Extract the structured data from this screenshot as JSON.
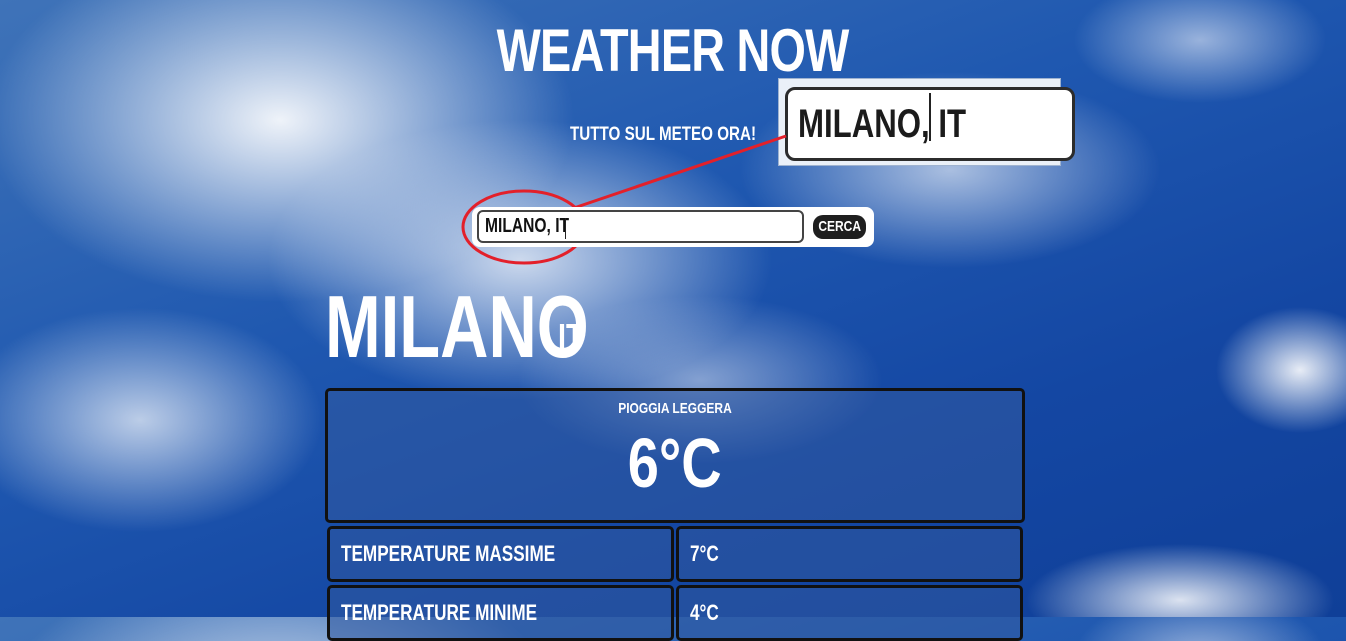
{
  "app": {
    "title": "WEATHER NOW",
    "subtitle": "TUTTO SUL METEO ORA!"
  },
  "search": {
    "value": "MILANO, IT",
    "button_label": "CERCA"
  },
  "zoom_callout": {
    "value": "MILANO, IT"
  },
  "location": {
    "city": "MILANO",
    "country": "IT"
  },
  "current": {
    "description": "PIOGGIA LEGGERA",
    "temperature": "6°C"
  },
  "details": [
    {
      "label": "TEMPERATURE MASSIME",
      "value": "7°C"
    },
    {
      "label": "TEMPERATURE MINIME",
      "value": "4°C"
    }
  ],
  "colors": {
    "annotation": "#e3202a",
    "button": "#1f1f1f",
    "panel": "#325aa0"
  }
}
